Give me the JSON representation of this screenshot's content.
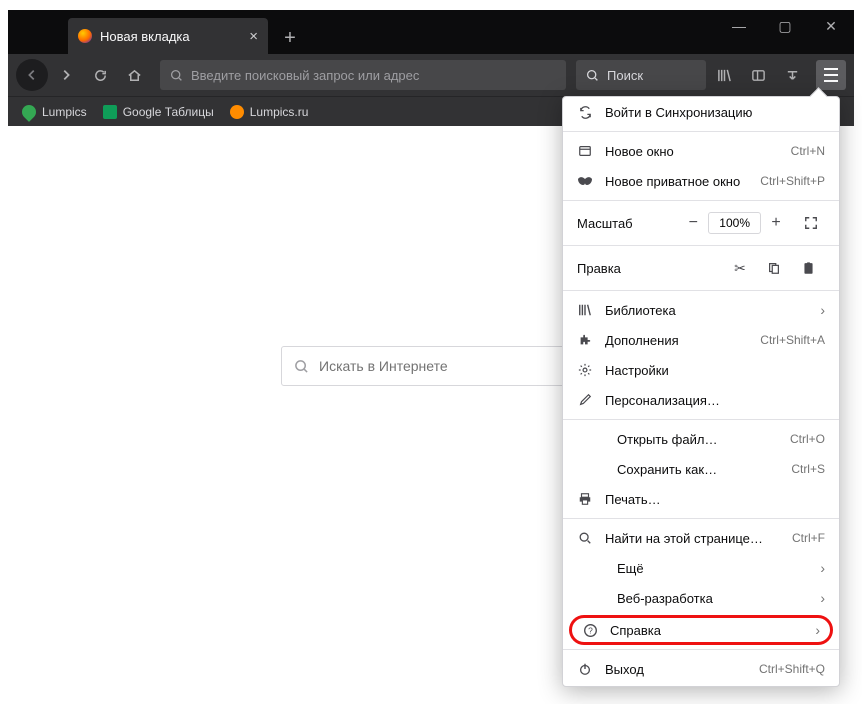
{
  "tab": {
    "title": "Новая вкладка"
  },
  "urlbar": {
    "placeholder": "Введите поисковый запрос или адрес"
  },
  "searchbar": {
    "placeholder": "Поиск"
  },
  "bookmarks": [
    {
      "label": "Lumpics"
    },
    {
      "label": "Google Таблицы"
    },
    {
      "label": "Lumpics.ru"
    }
  ],
  "content_search": {
    "placeholder": "Искать в Интернете"
  },
  "menu": {
    "sync": "Войти в Синхронизацию",
    "new_window": "Новое окно",
    "new_window_sc": "Ctrl+N",
    "new_private": "Новое приватное окно",
    "new_private_sc": "Ctrl+Shift+P",
    "zoom_label": "Масштаб",
    "zoom_value": "100%",
    "edit_label": "Правка",
    "library": "Библиотека",
    "addons": "Дополнения",
    "addons_sc": "Ctrl+Shift+A",
    "settings": "Настройки",
    "customize": "Персонализация…",
    "open_file": "Открыть файл…",
    "open_file_sc": "Ctrl+O",
    "save_as": "Сохранить как…",
    "save_as_sc": "Ctrl+S",
    "print": "Печать…",
    "find": "Найти на этой странице…",
    "find_sc": "Ctrl+F",
    "more": "Ещё",
    "webdev": "Веб-разработка",
    "help": "Справка",
    "exit": "Выход",
    "exit_sc": "Ctrl+Shift+Q"
  }
}
